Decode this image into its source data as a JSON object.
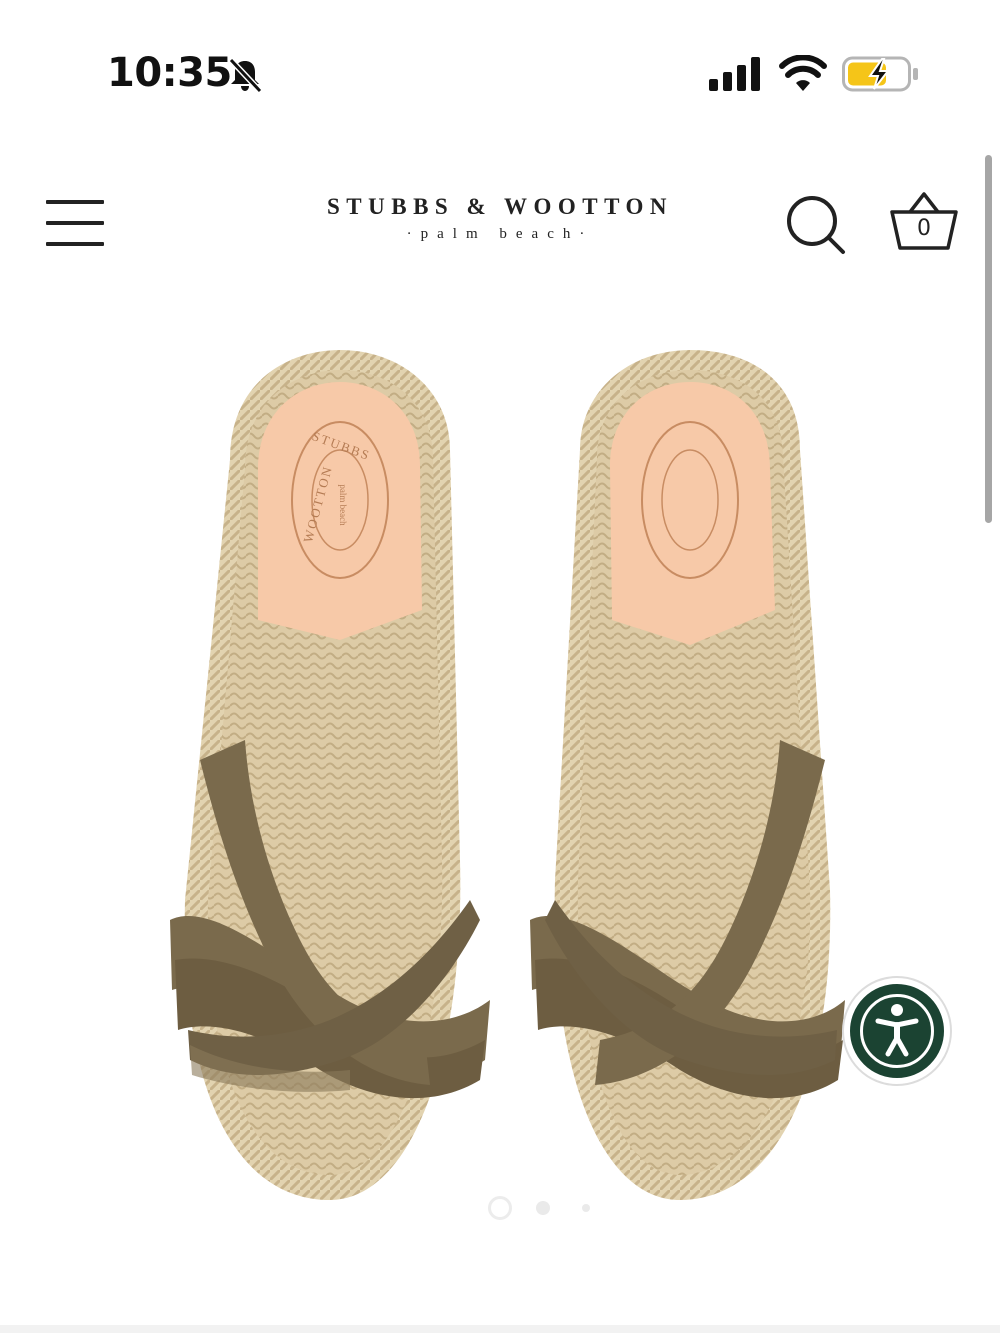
{
  "status_bar": {
    "time": "10:35",
    "icons": [
      "bell-off-icon",
      "signal-icon",
      "wifi-icon",
      "battery-charging-icon"
    ],
    "battery_color": "#f5c518"
  },
  "header": {
    "brand_name": "STUBBS & WOOTTON",
    "brand_sub": "·palm beach·",
    "cart_count": "0",
    "icons": [
      "menu-icon",
      "search-icon",
      "cart-icon"
    ]
  },
  "product": {
    "insole_stamp_top": "STUBBS",
    "insole_stamp_center": "palm beach",
    "insole_stamp_bottom": "WOOTTON",
    "strap_color": "#7a6a4c",
    "insole_color": "#f7c9a8",
    "jute_color": "#d9c7a0"
  },
  "carousel": {
    "slide_count": 3,
    "active_index": 0
  },
  "accessibility": {
    "icon": "accessibility-icon",
    "color": "#1b4332"
  }
}
